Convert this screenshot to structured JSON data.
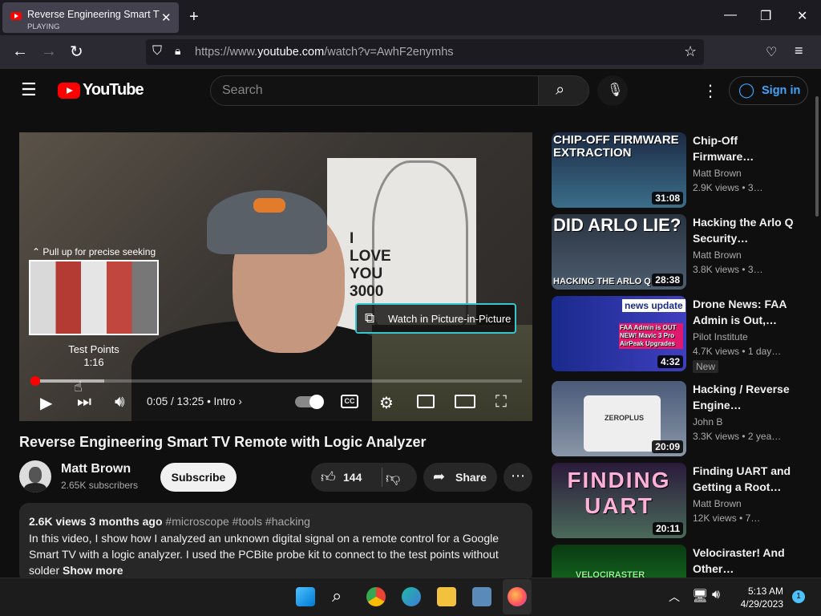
{
  "browser": {
    "tab_title": "Reverse Engineering Smart TV R",
    "tab_status": "PLAYING",
    "new_tab": "+",
    "url_prefix": "https://www.",
    "url_domain": "youtube.com",
    "url_rest": "/watch?v=AwhF2enymhs"
  },
  "youtube": {
    "logo_text": "YouTube",
    "search_placeholder": "Search",
    "sign_in": "Sign in"
  },
  "player": {
    "poster_text": "I LOVE YOU 3000",
    "pull_up_hint": "Pull up for precise seeking",
    "preview_chapter": "Test Points",
    "preview_time": "1:16",
    "pip_label": "Watch in Picture-in-Picture",
    "time_display": "0:05 / 13:25",
    "chapter": "Intro",
    "cc_label": "CC",
    "progress_fraction": 0.006
  },
  "video": {
    "title": "Reverse Engineering Smart TV Remote with Logic Analyzer",
    "channel": "Matt Brown",
    "subscribers": "2.65K subscribers",
    "subscribe": "Subscribe",
    "likes": "144",
    "share": "Share",
    "views": "2.6K views",
    "age": "3 months ago",
    "tags": "#microscope #tools #hacking",
    "description": "In this video, I show how I analyzed an unknown digital signal on a remote control for a Google Smart TV with a logic analyzer. I used the PCBite probe kit to connect to the test points without solder",
    "show_more": "Show more"
  },
  "recommendations": [
    {
      "thumb_text": "CHIP-OFF FIRMWARE EXTRACTION",
      "duration": "31:08",
      "title": "Chip-Off Firmware…",
      "channel": "Matt Brown",
      "views": "2.9K views",
      "age": "3…",
      "thumb_color": "#2b4a78"
    },
    {
      "thumb_text": "DID ARLO LIE?",
      "thumb_text2": "HACKING THE ARLO Q",
      "duration": "28:38",
      "title": "Hacking the Arlo Q Security…",
      "channel": "Matt Brown",
      "views": "3.8K views",
      "age": "3…",
      "thumb_color": "#3b4f6a"
    },
    {
      "thumb_text": "news update",
      "thumb_text2": "FAA Admin is OUT NEW! Mavic 3 Pro AirPeak Upgrades",
      "duration": "4:32",
      "title": "Drone News: FAA Admin is Out,…",
      "channel": "Pilot Institute",
      "views": "4.7K views",
      "age": "1 day…",
      "badge": "New",
      "thumb_color": "#2a3a9c"
    },
    {
      "thumb_text": "ZEROPLUS",
      "duration": "20:09",
      "title": "Hacking / Reverse Engine…",
      "channel": "John B",
      "views": "3.3K views",
      "age": "2 yea…",
      "thumb_color": "#5a6a80"
    },
    {
      "thumb_text": "FINDING UART",
      "duration": "20:11",
      "title": "Finding UART and Getting a Root…",
      "channel": "Matt Brown",
      "views": "12K views",
      "age": "7…",
      "thumb_color": "#3a2a4a"
    },
    {
      "thumb_text": "VELOCIRASTER",
      "duration": "",
      "title": "Velociraster! And Other…",
      "channel": "",
      "views": "",
      "age": "",
      "thumb_color": "#0f5a1a"
    }
  ],
  "taskbar": {
    "time": "5:13 AM",
    "date": "4/29/2023",
    "notifications": "1"
  }
}
